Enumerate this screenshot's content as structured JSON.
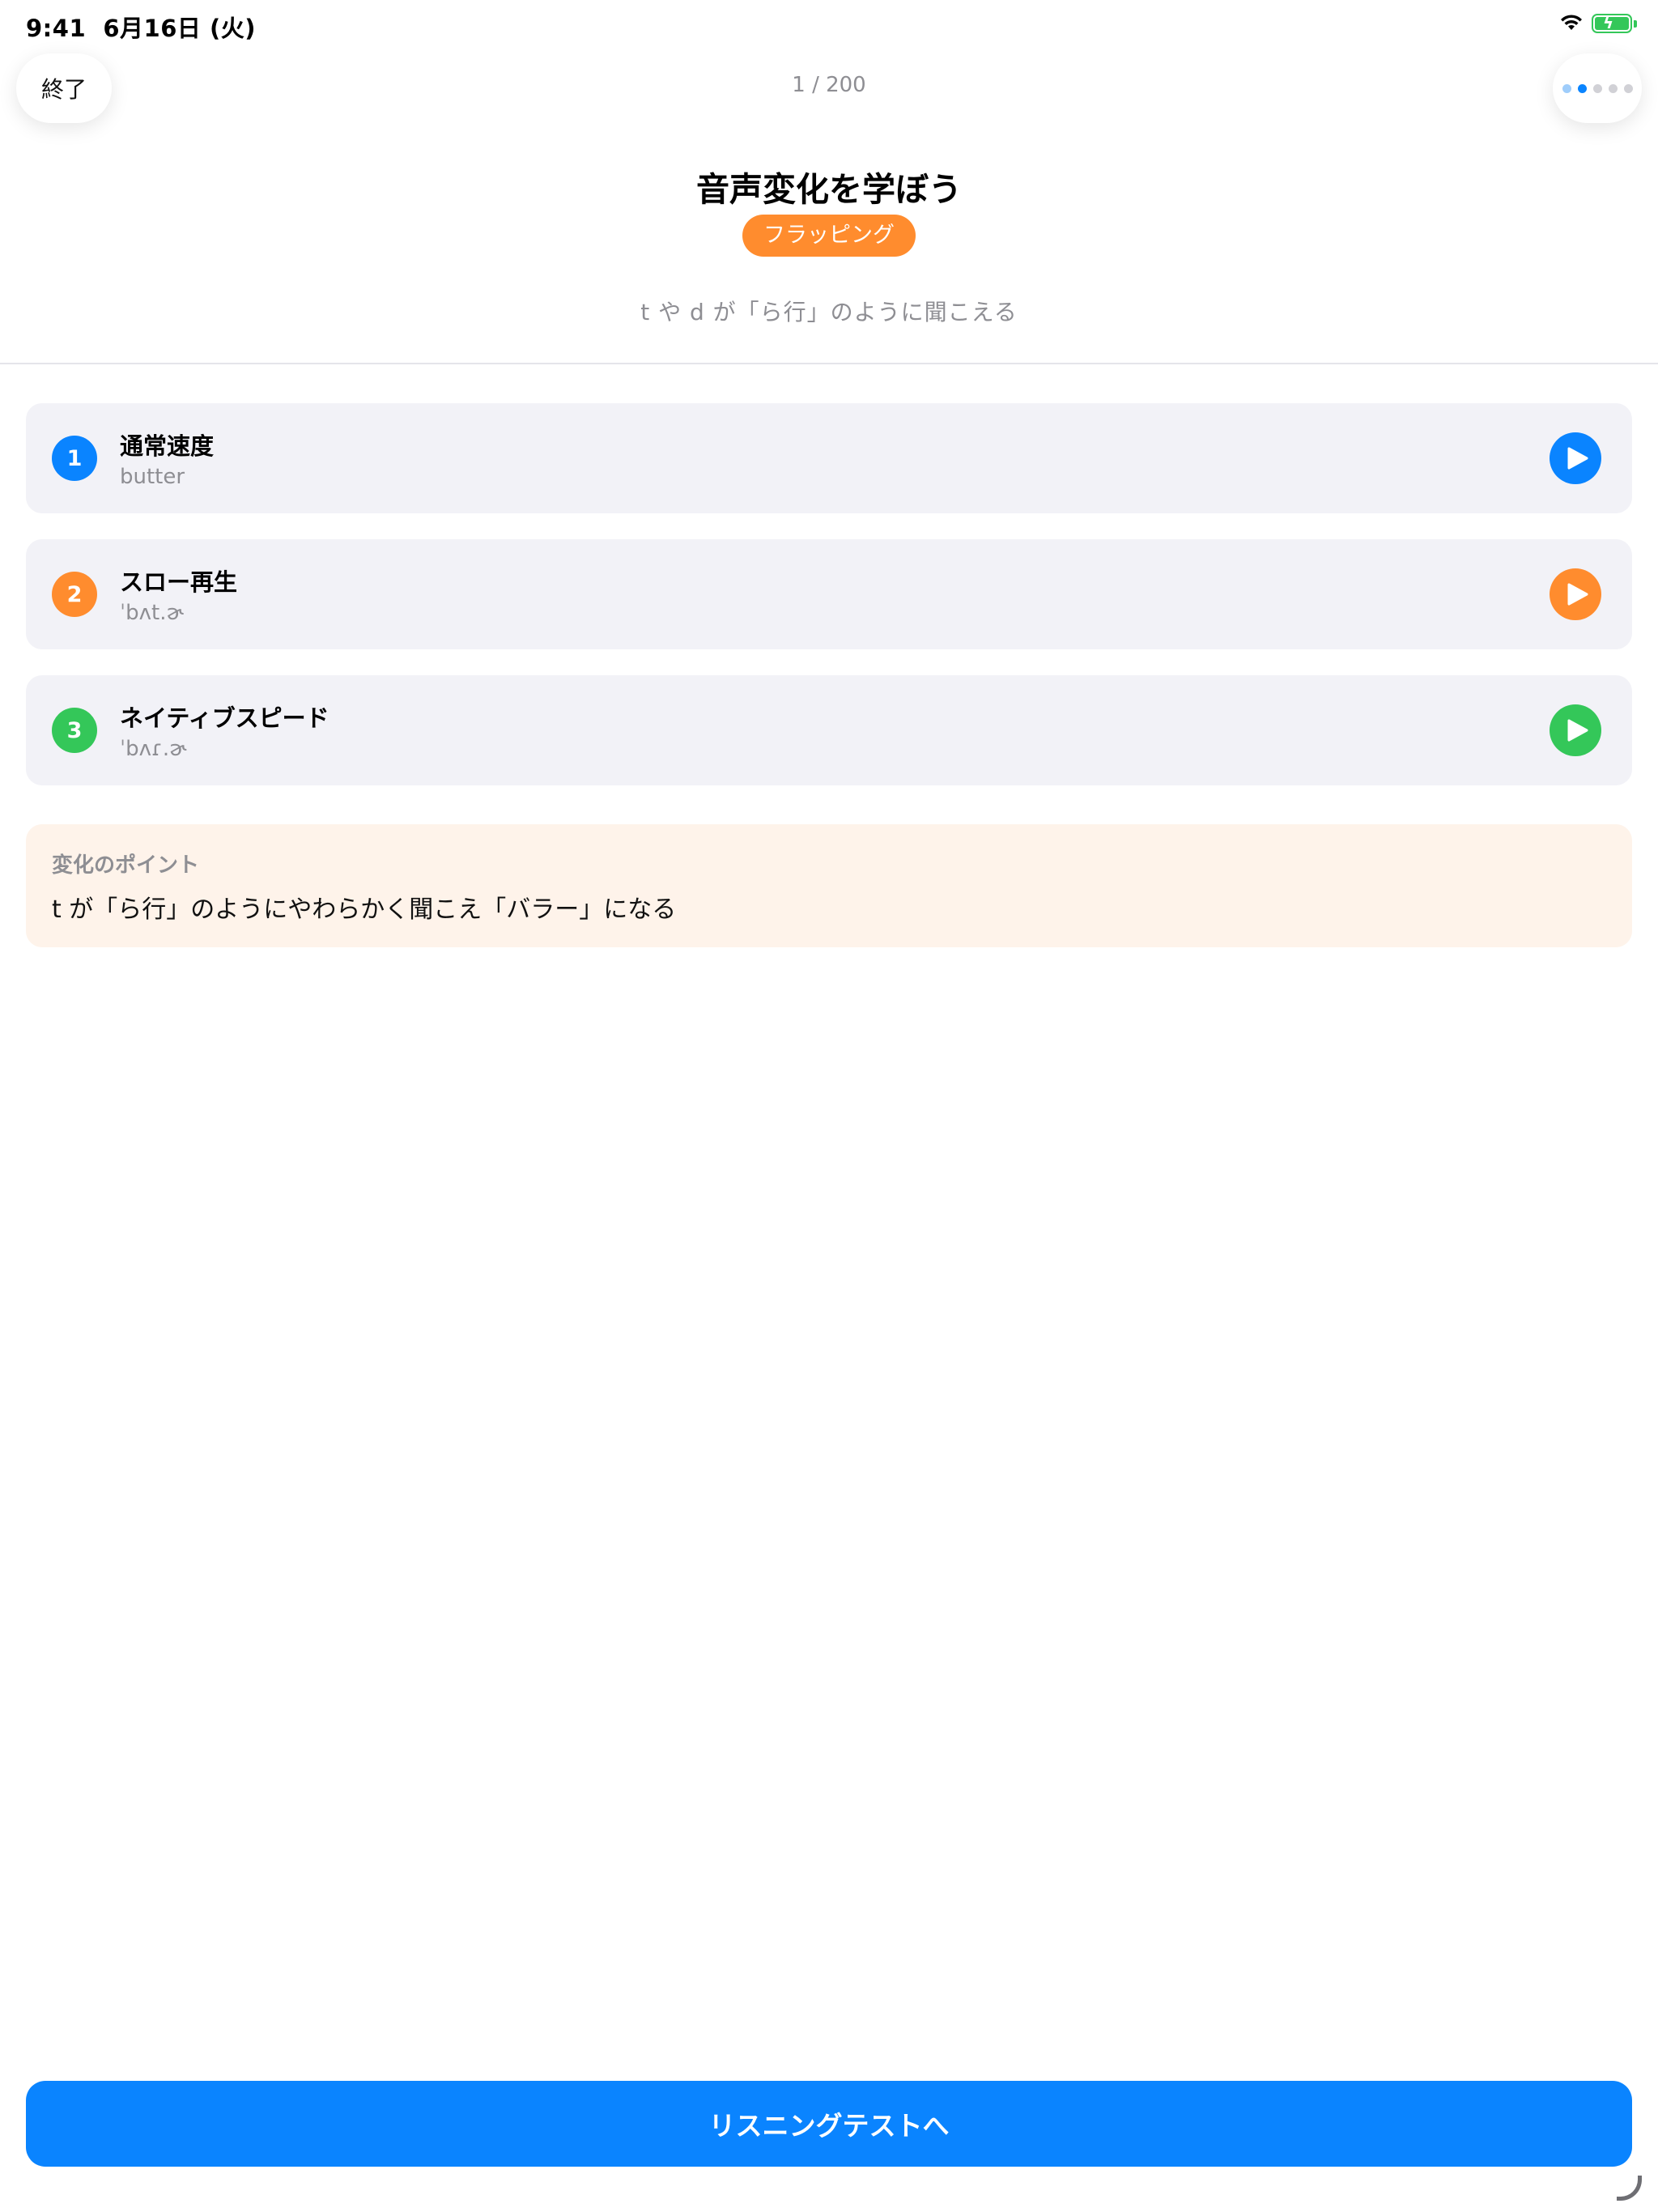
{
  "status_bar": {
    "time": "9:41",
    "date": "6月16日 (火)",
    "wifi_icon": "wifi-icon",
    "battery_icon": "battery-charging-icon"
  },
  "header": {
    "end_button": "終了",
    "progress": "1 / 200",
    "page_dots_total": 5,
    "page_dots_active": 1
  },
  "lesson": {
    "title": "音声変化を学ぼう",
    "tag": "フラッピング",
    "description": "t や d が「ら行」のように聞こえる"
  },
  "items": [
    {
      "number": "1",
      "title": "通常速度",
      "subtitle": "butter",
      "color": "#0a84ff",
      "icon": "play-icon"
    },
    {
      "number": "2",
      "title": "スロー再生",
      "subtitle": "ˈbʌt.ɚ",
      "color": "#ff8c2e",
      "icon": "play-icon"
    },
    {
      "number": "3",
      "title": "ネイティブスピード",
      "subtitle": "ˈbʌɾ.ɚ",
      "color": "#34c759",
      "icon": "play-icon"
    }
  ],
  "point": {
    "label": "変化のポイント",
    "text": "t が「ら行」のようにやわらかく聞こえ「バラー」になる"
  },
  "cta": {
    "label": "リスニングテストへ",
    "color": "#0a84ff"
  },
  "colors": {
    "tag": "#ff8c2e",
    "point_bg": "#fef3ea",
    "card_bg": "#f2f2f7",
    "secondary_text": "#8e8e93"
  }
}
